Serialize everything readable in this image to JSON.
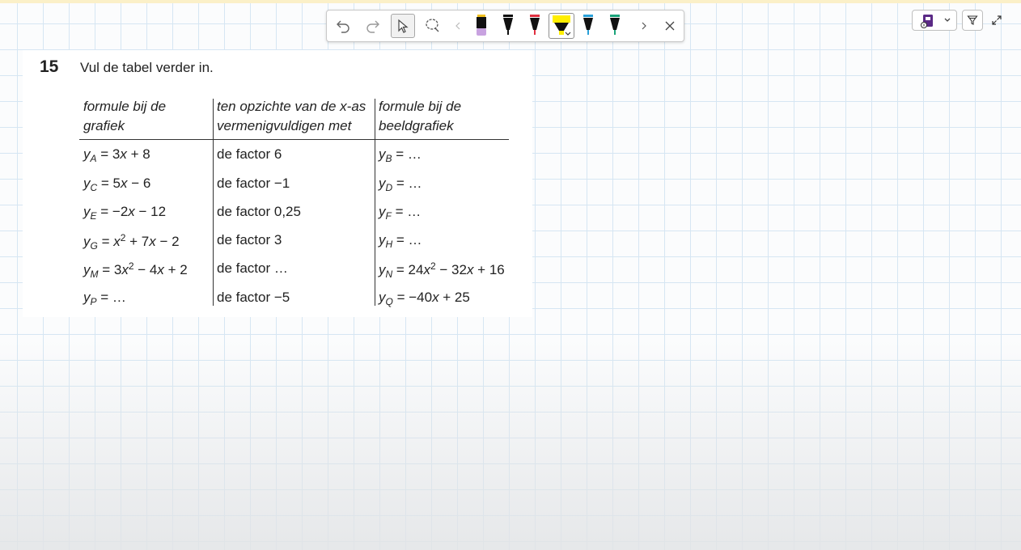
{
  "question": {
    "number": "15",
    "text": "Vul de tabel verder in."
  },
  "table": {
    "headers": [
      [
        "formule bij de",
        "grafiek"
      ],
      [
        "ten opzichte van de x-as",
        "vermenigvuldigen met"
      ],
      [
        "formule bij de",
        "beeldgrafiek"
      ]
    ],
    "factors": [
      "de factor 6",
      "de factor −1",
      "de factor 0,25",
      "de factor 3",
      "de factor …",
      "de factor −5"
    ],
    "rows_text": {
      "r1c1": "yA = 3x + 8",
      "r1c3": "yB = …",
      "r2c1": "yC = 5x − 6",
      "r2c3": "yD = …",
      "r3c1": "yE = −2x − 12",
      "r3c3": "yF = …",
      "r4c1": "yG = x2 + 7x − 2",
      "r4c3": "yH = …",
      "r5c1": "yM = 3x2 − 4x + 2",
      "r5c3": "yN = 24x2 − 32x + 16",
      "r6c1": "yP = …",
      "r6c3": "yQ = −40x + 25"
    }
  },
  "toolbar": {
    "icons": [
      "undo-icon",
      "redo-icon",
      "select-icon",
      "lasso-icon",
      "chevron-left-icon",
      "pen-purple-icon",
      "pen-black-icon",
      "pen-red-icon",
      "highlighter-yellow-icon",
      "pen-blue-icon",
      "pen-green-icon",
      "chevron-right-icon",
      "close-icon"
    ],
    "colors": {
      "purple": "#c8a2e0",
      "black": "#111111",
      "red": "#e03040",
      "yellow": "#ffee00",
      "blue": "#2aa0d8",
      "green": "#1aa37a"
    }
  },
  "right_controls": {
    "icons": [
      "notebook-icon",
      "chevron-down-icon",
      "filter-icon",
      "expand-icon"
    ],
    "accent": "#5b2a86"
  }
}
